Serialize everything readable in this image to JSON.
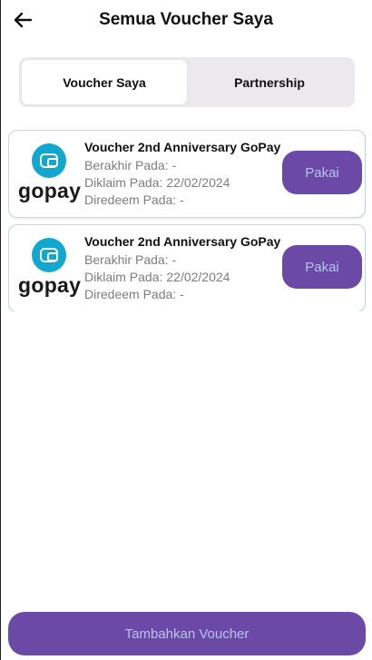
{
  "header": {
    "title": "Semua Voucher Saya",
    "back_icon": "arrow-left-icon"
  },
  "tabs": [
    {
      "label": "Voucher Saya",
      "active": true
    },
    {
      "label": "Partnership",
      "active": false
    }
  ],
  "vouchers": [
    {
      "brand": "gopay",
      "brand_icon": "wallet-icon",
      "title": "Voucher 2nd Anniversary GoPay",
      "expires_label": "Berakhir Pada:",
      "expires_value": "-",
      "claimed_label": "Diklaim Pada:",
      "claimed_value": "22/02/2024",
      "redeemed_label": "Diredeem Pada:",
      "redeemed_value": "-",
      "action_label": "Pakai"
    },
    {
      "brand": "gopay",
      "brand_icon": "wallet-icon",
      "title": "Voucher 2nd Anniversary GoPay",
      "expires_label": "Berakhir Pada:",
      "expires_value": "-",
      "claimed_label": "Diklaim Pada:",
      "claimed_value": "22/02/2024",
      "redeemed_label": "Diredeem Pada:",
      "redeemed_value": "-",
      "action_label": "Pakai"
    }
  ],
  "footer": {
    "add_label": "Tambahkan Voucher"
  },
  "colors": {
    "accent": "#6a4aa6",
    "button_text": "#b9c2ee",
    "gopay_blue": "#12a7cf",
    "card_border": "#b9dbe8"
  }
}
